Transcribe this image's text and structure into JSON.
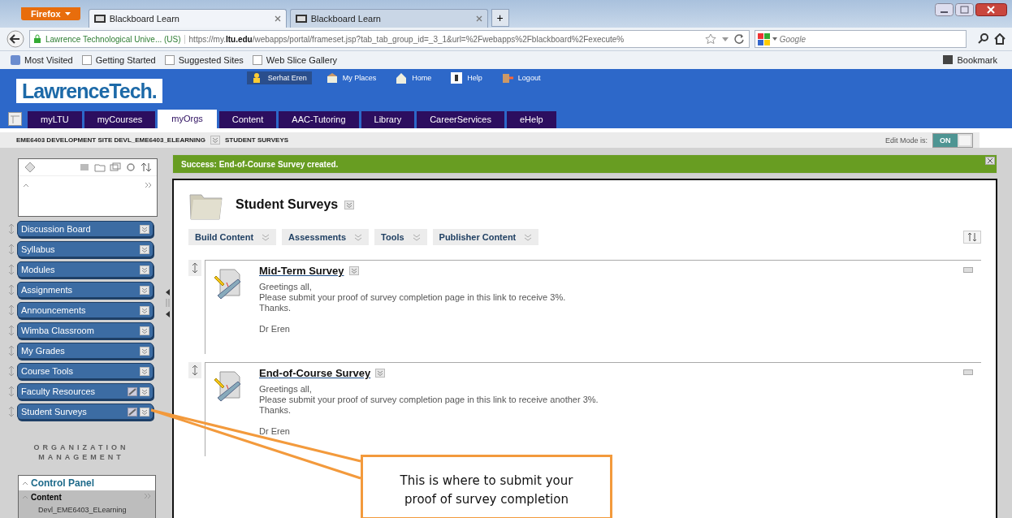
{
  "browser": {
    "app_button": "Firefox",
    "tabs": [
      {
        "title": "Blackboard Learn",
        "selected": true
      },
      {
        "title": "Blackboard Learn",
        "selected": false
      }
    ],
    "new_tab": "+",
    "identity": "Lawrence Technological Unive... (US)",
    "url": "https://my.**ltu.edu**/webapps/portal/frameset.jsp?tab_tab_group_id=_3_1&url=%2Fwebapps%2Fblackboard%2Fexecute%",
    "search_placeholder": "Google",
    "bookmarks": [
      "Most Visited",
      "Getting Started",
      "Suggested Sites",
      "Web Slice Gallery"
    ],
    "bookmarks_menu": "Bookmark"
  },
  "header": {
    "logo": "LawrenceTech.",
    "links": [
      "Serhat Eren",
      "My Places",
      "Home",
      "Help",
      "Logout"
    ]
  },
  "tabs": [
    {
      "label": "myLTU",
      "selected": false
    },
    {
      "label": "myCourses",
      "selected": false
    },
    {
      "label": "myOrgs",
      "selected": true
    },
    {
      "label": "Content",
      "selected": false
    },
    {
      "label": "AAC-Tutoring",
      "selected": false
    },
    {
      "label": "Library",
      "selected": false
    },
    {
      "label": "CareerServices",
      "selected": false
    },
    {
      "label": "eHelp",
      "selected": false
    }
  ],
  "breadcrumb": [
    "EME6403 DEVELOPMENT SITE DEVL_EME6403_ELEARNING",
    "STUDENT SURVEYS"
  ],
  "edit_mode": {
    "label": "Edit Mode is:",
    "value": "ON",
    "on": true
  },
  "sidebar": {
    "menu": [
      {
        "label": "Discussion Board",
        "kind": "tool"
      },
      {
        "label": "Syllabus",
        "kind": "tool"
      },
      {
        "label": "Modules",
        "kind": "tool"
      },
      {
        "label": "Assignments",
        "kind": "tool"
      },
      {
        "label": "Announcements",
        "kind": "tool"
      },
      {
        "label": "Wimba Classroom",
        "kind": "tool"
      },
      {
        "label": "My Grades",
        "kind": "tool"
      },
      {
        "label": "Course Tools",
        "kind": "tool"
      },
      {
        "label": "Faculty Resources",
        "kind": "hidden"
      },
      {
        "label": "Student Surveys",
        "kind": "hidden"
      }
    ],
    "section_title": "ORGANIZATION MANAGEMENT",
    "panel_title": "Control Panel",
    "panel_section": "Content",
    "panel_item": "Devl_EME6403_ELearning"
  },
  "success_message": "Success: End-of-Course Survey created.",
  "page_title": "Student Surveys",
  "actions": [
    "Build Content",
    "Assessments",
    "Tools",
    "Publisher Content"
  ],
  "items": [
    {
      "title": "Mid-Term Survey",
      "lines": [
        "Greetings all,",
        "Please submit your proof of survey completion page in this link to receive 3%.",
        "Thanks."
      ],
      "signature": "Dr Eren"
    },
    {
      "title": "End-of-Course Survey",
      "lines": [
        "Greetings all,",
        "Please submit your proof of survey completion page in this link to receive another 3%.",
        "Thanks."
      ],
      "signature": "Dr Eren"
    }
  ],
  "callout": "This is where to submit your proof of survey completion"
}
